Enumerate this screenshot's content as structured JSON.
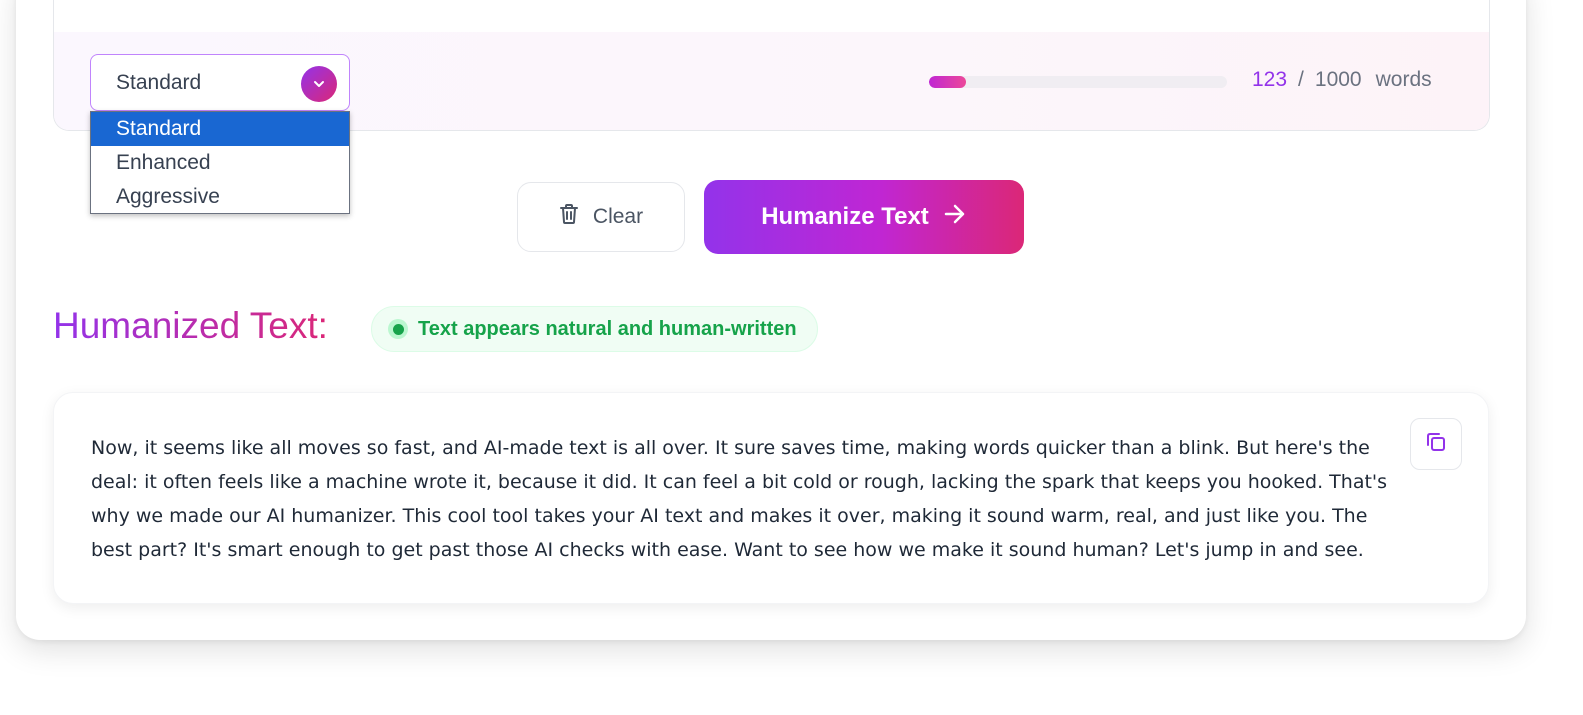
{
  "mode_select": {
    "selected": "Standard",
    "options": [
      "Standard",
      "Enhanced",
      "Aggressive"
    ]
  },
  "word_counter": {
    "current": "123",
    "separator": "/",
    "max": "1000",
    "unit": "words",
    "progress_fraction": 0.123
  },
  "actions": {
    "clear_label": "Clear",
    "humanize_label": "Humanize Text"
  },
  "result": {
    "title": "Humanized Text:",
    "status_text": "Text appears natural and human-written",
    "body": "Now, it seems like all moves so fast, and AI-made text is all over. It sure saves time, making words quicker than a blink. But here's the deal: it often feels like a machine wrote it, because it did. It can feel a bit cold or rough, lacking the spark that keeps you hooked. That's why we made our AI humanizer. This cool tool takes your AI text and makes it over, making it sound warm, real, and just like you. The best part? It's smart enough to get past those AI checks with ease. Want to see how we make it sound human? Let's jump in and see."
  },
  "colors": {
    "accent_purple": "#9333ea",
    "accent_pink": "#db2777",
    "status_green": "#16a34a",
    "selected_option_bg": "#1967d2"
  },
  "icons": {
    "select_chevron": "chevron-down-icon",
    "clear": "trash-icon",
    "humanize": "arrow-right-icon",
    "copy": "copy-icon",
    "status": "status-dot-icon"
  }
}
